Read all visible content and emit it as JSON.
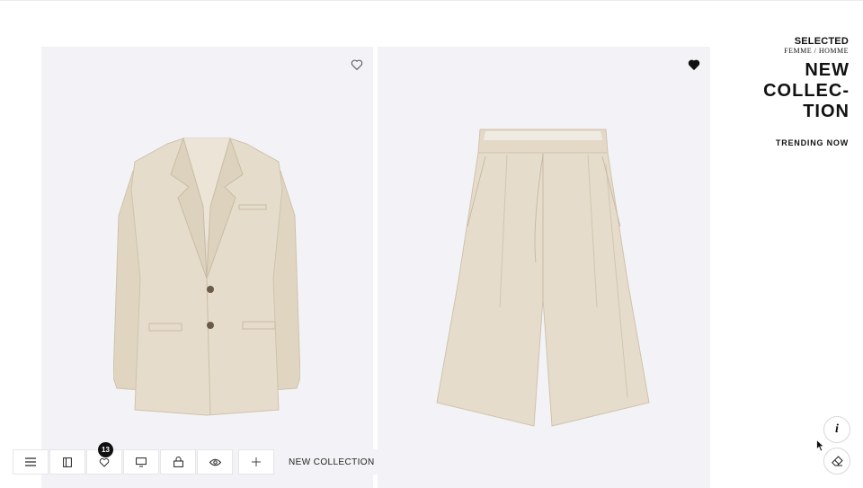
{
  "brand": {
    "name": "SELECTED",
    "subtitle": "FEMME / HOMME"
  },
  "collection_title": "NEW COLLEC-\nTION",
  "trending_label": "TRENDING NOW",
  "products": [
    {
      "name": "linen blazer",
      "image_icon": "blazer-image",
      "favorited": false
    },
    {
      "name": "linen shorts",
      "image_icon": "shorts-image",
      "favorited": true
    }
  ],
  "toolbar": {
    "items": [
      {
        "icon": "menu-icon"
      },
      {
        "icon": "catalog-icon"
      },
      {
        "icon": "heart-icon",
        "badge": "13"
      },
      {
        "icon": "monitor-icon"
      },
      {
        "icon": "bag-icon"
      },
      {
        "icon": "eye-icon"
      },
      {
        "icon": "plus-icon"
      }
    ],
    "label": "NEW COLLECTION"
  },
  "side_buttons": {
    "info_glyph": "i",
    "eraser_icon": "eraser-icon"
  },
  "colors": {
    "panel_bg": "#f3f3f7",
    "linen": "#e3d8c5",
    "badge": "#111111"
  }
}
